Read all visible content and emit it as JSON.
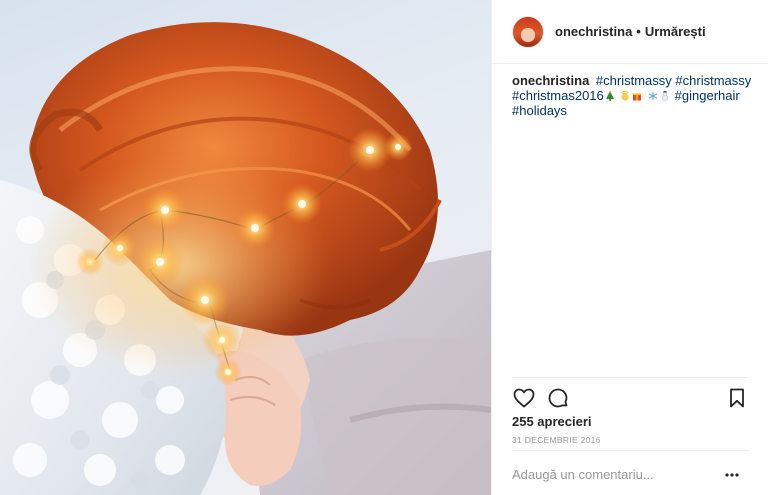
{
  "header": {
    "username": "onechristina",
    "separator": "•",
    "follow_label": "Urmărești"
  },
  "caption": {
    "username": "onechristina",
    "tags": [
      "#christmassy",
      "#christmassy",
      "#christmas2016"
    ],
    "emoji": [
      "christmas-tree-icon",
      "angel-icon",
      "gift-icon",
      "snowflake-icon",
      "snowman-icon"
    ],
    "tags_after": [
      "#gingerhair",
      "#holidays"
    ]
  },
  "actions": {
    "icons": [
      "heart-icon",
      "comment-bubble-icon",
      "bookmark-icon"
    ]
  },
  "likes": {
    "label": "255 aprecieri"
  },
  "date": {
    "label": "31 DECEMBRIE 2016"
  },
  "comment": {
    "placeholder": "Adaugă un comentariu...",
    "more_icon": "ellipsis-icon"
  },
  "colors": {
    "hashtag": "#003569",
    "text": "#262626",
    "muted": "#999999",
    "hair": "#d9652a",
    "light": "#ffd36b"
  }
}
